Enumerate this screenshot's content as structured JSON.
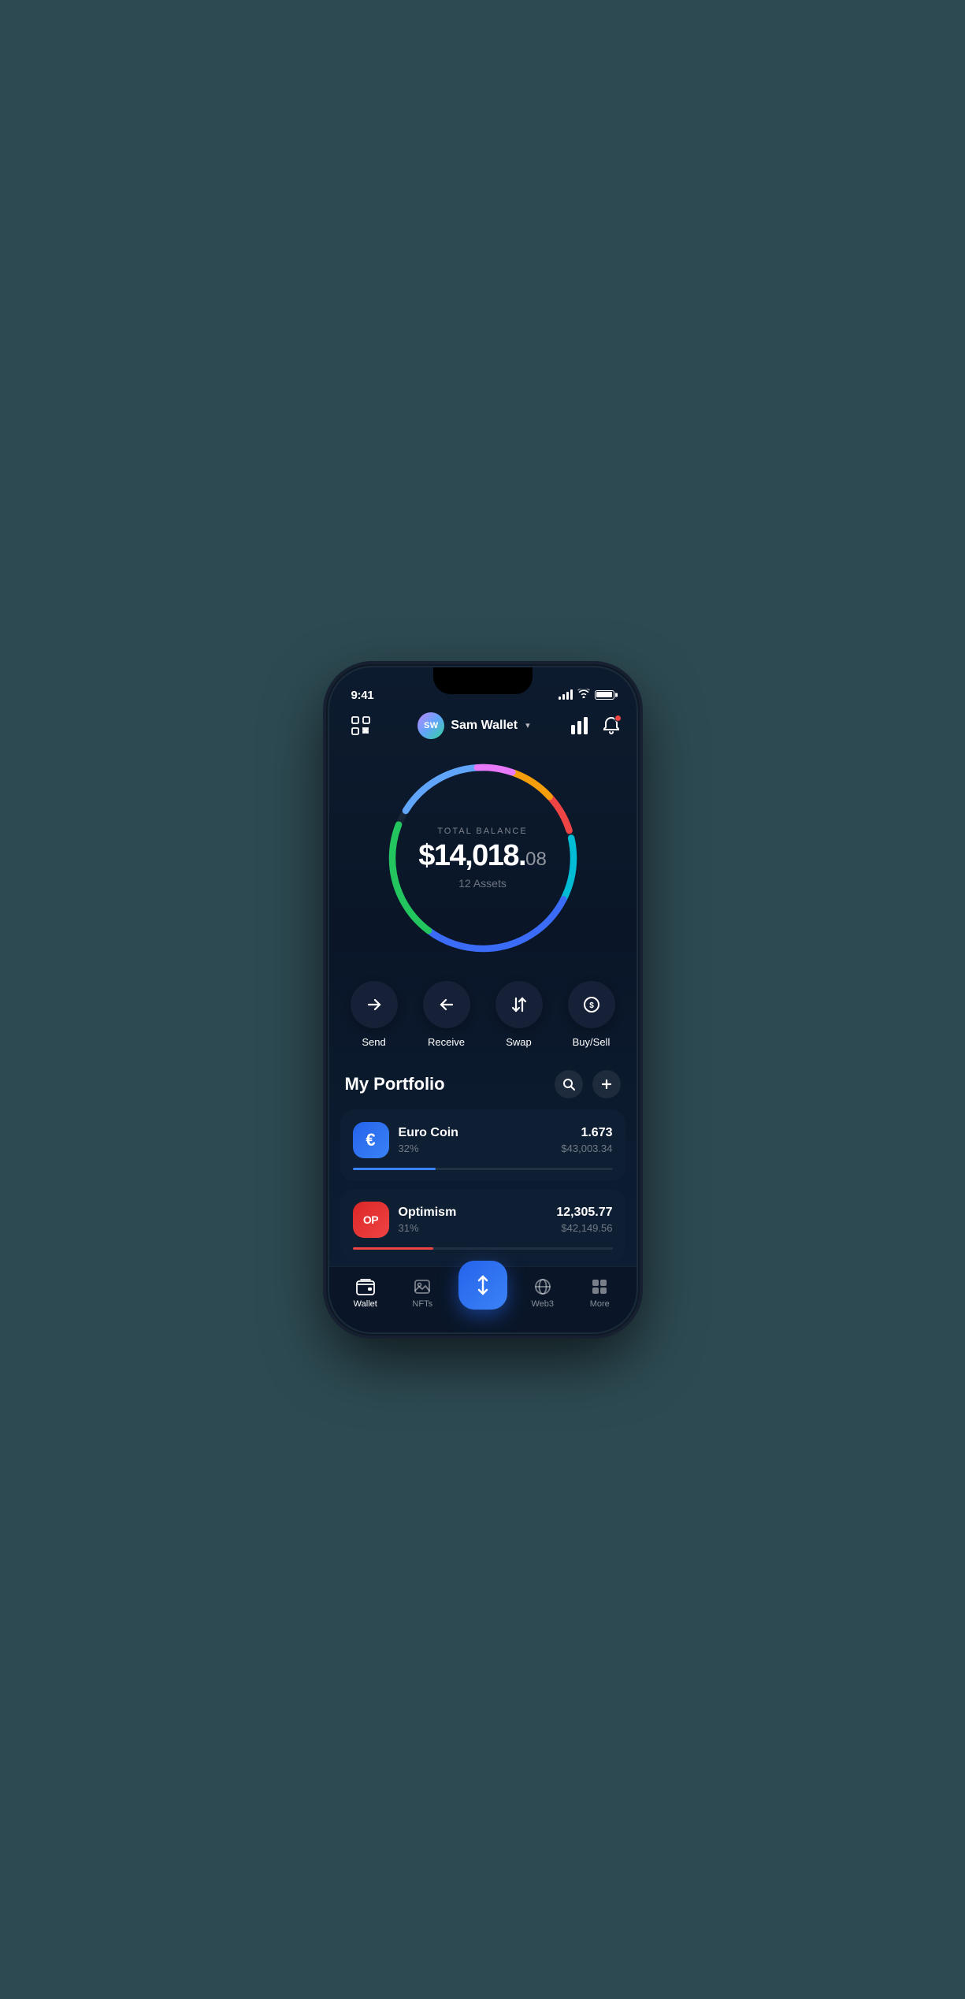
{
  "statusBar": {
    "time": "9:41"
  },
  "header": {
    "avatarInitials": "SW",
    "userName": "Sam Wallet",
    "chevron": "▾",
    "scanLabel": "scan",
    "chartLabel": "chart",
    "bellLabel": "bell"
  },
  "balance": {
    "totalBalanceLabel": "TOTAL BALANCE",
    "amountWhole": "$14,018.",
    "amountCents": "08",
    "assetsCount": "12 Assets"
  },
  "actions": [
    {
      "id": "send",
      "label": "Send",
      "icon": "→"
    },
    {
      "id": "receive",
      "label": "Receive",
      "icon": "←"
    },
    {
      "id": "swap",
      "label": "Swap",
      "icon": "⇅"
    },
    {
      "id": "buysell",
      "label": "Buy/Sell",
      "icon": "$"
    }
  ],
  "portfolio": {
    "title": "My Portfolio",
    "searchLabel": "search",
    "addLabel": "add",
    "assets": [
      {
        "id": "euro-coin",
        "name": "Euro Coin",
        "pct": "32%",
        "amount": "1.673",
        "usd": "$43,003.34",
        "progressPct": 32,
        "iconType": "euro",
        "progressColor": "blue"
      },
      {
        "id": "optimism",
        "name": "Optimism",
        "pct": "31%",
        "amount": "12,305.77",
        "usd": "$42,149.56",
        "progressPct": 31,
        "iconType": "op",
        "progressColor": "red"
      }
    ]
  },
  "bottomNav": {
    "items": [
      {
        "id": "wallet",
        "label": "Wallet",
        "active": true
      },
      {
        "id": "nfts",
        "label": "NFTs",
        "active": false
      },
      {
        "id": "center",
        "label": "",
        "isCenter": true
      },
      {
        "id": "web3",
        "label": "Web3",
        "active": false
      },
      {
        "id": "more",
        "label": "More",
        "active": false
      }
    ]
  }
}
